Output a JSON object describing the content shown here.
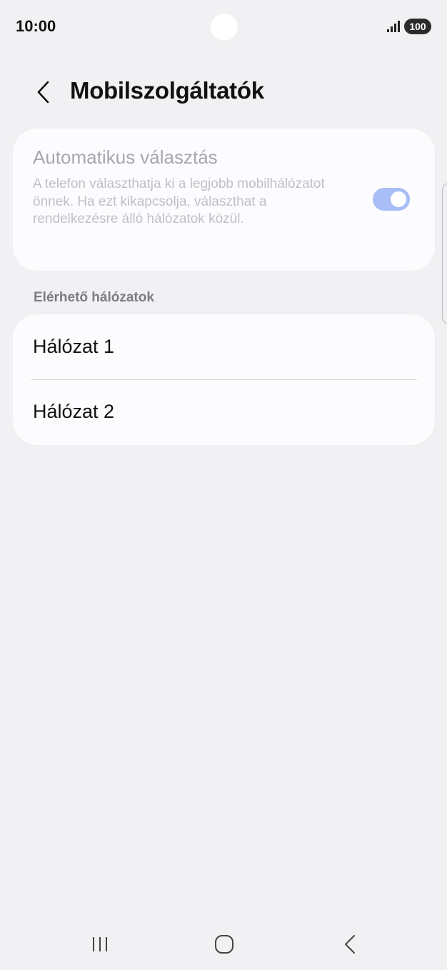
{
  "status_bar": {
    "time": "10:00",
    "battery": "100",
    "icons": [
      "signal-icon",
      "battery-icon"
    ]
  },
  "header": {
    "title": "Mobilszolgáltatók",
    "back_icon": "chevron-left-icon"
  },
  "automatic_selection": {
    "title": "Automatikus választás",
    "description": "A telefon választhatja ki a legjobb mobilhálózatot önnek. Ha ezt kikapcsolja, választhat a rendelkezésre álló hálózatok közül.",
    "enabled": true,
    "toggle_color": "#a9bdf7"
  },
  "networks": {
    "section_label": "Elérhető hálózatok",
    "items": [
      {
        "label": "Hálózat 1"
      },
      {
        "label": "Hálózat 2"
      }
    ]
  },
  "nav_bar": {
    "icons": [
      "recents-icon",
      "home-icon",
      "back-icon"
    ]
  }
}
